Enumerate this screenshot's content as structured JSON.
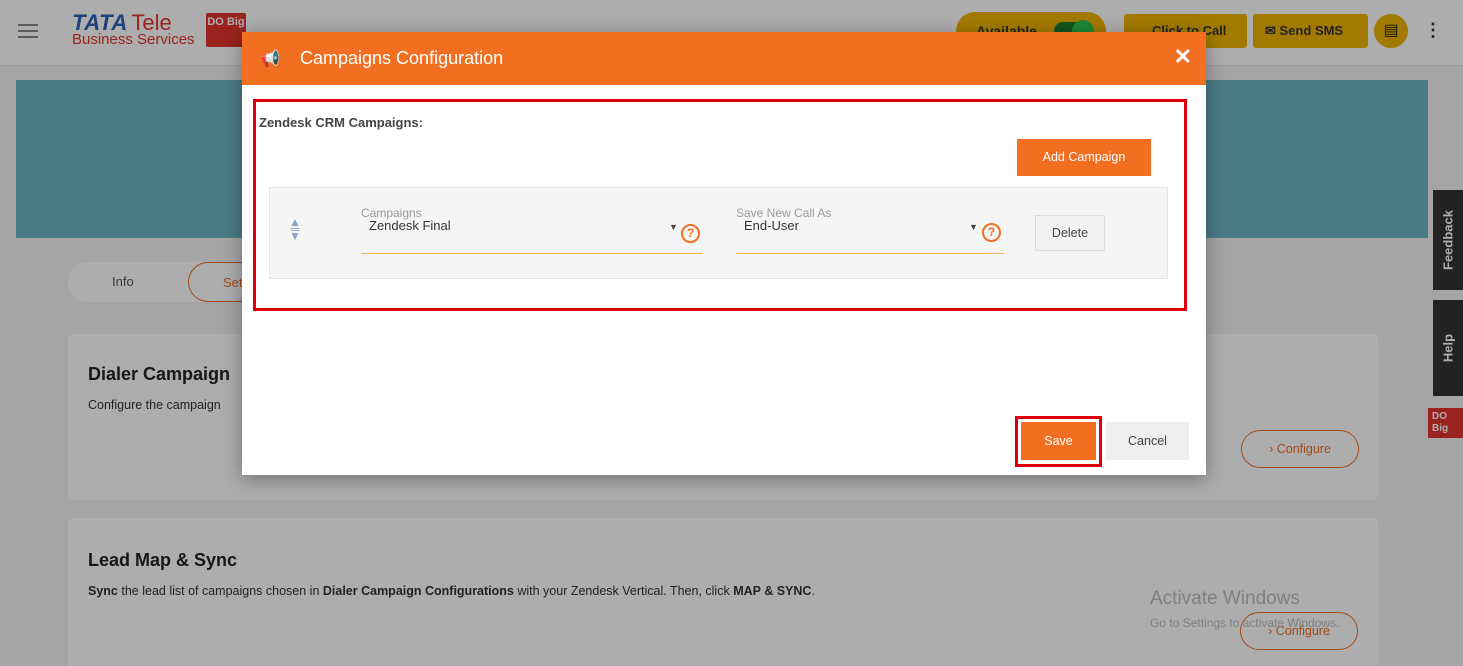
{
  "header": {
    "logo_main": "TATA",
    "logo_tele": "Tele",
    "logo_sub": "Business Services",
    "dobig": "DO Big",
    "status": "Available",
    "click_to_call": "Click to Call",
    "send_sms": "Send SMS"
  },
  "tabs": {
    "info": "Info",
    "settings": "Set"
  },
  "cards": {
    "dialer_title": "Dialer Campaign",
    "dialer_desc": "Configure the campaign",
    "lead_title": "Lead Map & Sync",
    "lead_desc_1": "Sync",
    "lead_desc_2": " the lead list of campaigns chosen in ",
    "lead_desc_3": "Dialer Campaign Configurations",
    "lead_desc_4": " with your Zendesk Vertical. Then, click ",
    "lead_desc_5": "MAP & SYNC",
    "lead_desc_6": ".",
    "configure": "Configure"
  },
  "side": {
    "feedback": "Feedback",
    "help": "Help",
    "dobig": "DO Big"
  },
  "watermark": {
    "line1": "Activate Windows",
    "line2": "Go to Settings to activate Windows."
  },
  "modal": {
    "title": "Campaigns Configuration",
    "close": "✕",
    "section_title": "Zendesk CRM Campaigns:",
    "add_campaign": "Add Campaign",
    "row": {
      "campaigns_label": "Campaigns",
      "campaigns_value": "Zendesk Final",
      "save_as_label": "Save New Call As",
      "save_as_value": "End-User",
      "delete": "Delete"
    },
    "save": "Save",
    "cancel": "Cancel"
  },
  "colors": {
    "accent": "#f26f21",
    "highlight": "#e0000d",
    "banner": "#6fb5c3",
    "yellow": "#f0b400"
  }
}
